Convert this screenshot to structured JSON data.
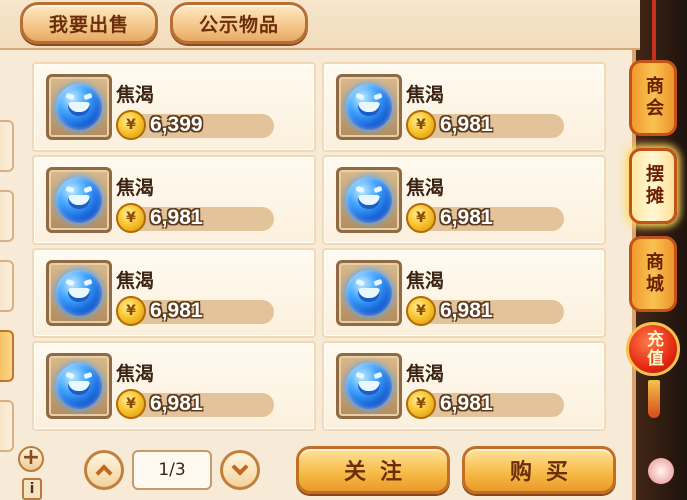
{
  "tabs": {
    "sell": "我要出售",
    "public": "公示物品"
  },
  "items": [
    {
      "name": "焦渴",
      "price": "6,399"
    },
    {
      "name": "焦渴",
      "price": "6,981"
    },
    {
      "name": "焦渴",
      "price": "6,981"
    },
    {
      "name": "焦渴",
      "price": "6,981"
    },
    {
      "name": "焦渴",
      "price": "6,981"
    },
    {
      "name": "焦渴",
      "price": "6,981"
    },
    {
      "name": "焦渴",
      "price": "6,981"
    },
    {
      "name": "焦渴",
      "price": "6,981"
    }
  ],
  "item_icon": "blue-fang-orb-icon",
  "currency_icon": "gold-coin-icon",
  "sidebar": [
    {
      "label": "商会"
    },
    {
      "label": "摆摊",
      "active": true
    },
    {
      "label": "商城"
    },
    {
      "label": "充值"
    }
  ],
  "pager": {
    "page": "1/3"
  },
  "actions": {
    "follow": "关注",
    "buy": "购买"
  },
  "misc": {
    "plus": "+",
    "info": "i"
  },
  "colors": {
    "accent": "#f6b944",
    "panel": "#f7ead6",
    "charge": "#e52a12"
  }
}
